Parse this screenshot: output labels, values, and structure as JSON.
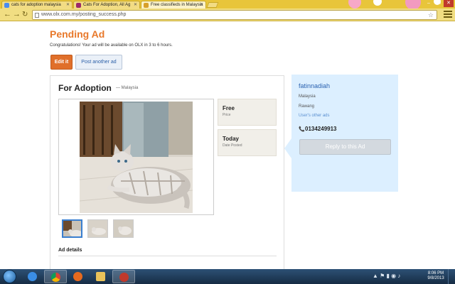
{
  "browser": {
    "tabs": [
      {
        "label": "cats for adoption malaysia",
        "icon": "google-icon",
        "color": "#4a8cf0"
      },
      {
        "label": "Cats For Adoption, All Ag",
        "icon": "olx-icon",
        "color": "#9b2a6a"
      },
      {
        "label": "Free classifieds in Malaysia",
        "icon": "olx-icon",
        "color": "#d8a02a"
      }
    ],
    "url": "www.olx.com.my/posting_success.php"
  },
  "page": {
    "heading": "Pending Ad",
    "congrats": "Congratulations! Your ad will be available on OLX in 3 to 6 hours.",
    "edit_label": "Edit it",
    "post_another_label": "Post another ad",
    "ad": {
      "title": "For Adoption",
      "location": "— Malaysia",
      "price_value": "Free",
      "price_label": "Price",
      "date_value": "Today",
      "date_label": "Date Posted",
      "details_label": "Ad details"
    },
    "seller": {
      "name": "fatinnadiah",
      "country": "Malaysia",
      "city": "Rawang",
      "other_ads": "User's other ads",
      "phone": "0134249913",
      "reply_label": "Reply to this Ad"
    }
  },
  "taskbar": {
    "time": "8:06 PM",
    "date": "9/8/2013"
  },
  "colors": {
    "accent_orange": "#e8782a",
    "link_blue": "#2b62b0",
    "seller_bg": "#dcefff",
    "chrome_theme": "#e8c53a"
  }
}
